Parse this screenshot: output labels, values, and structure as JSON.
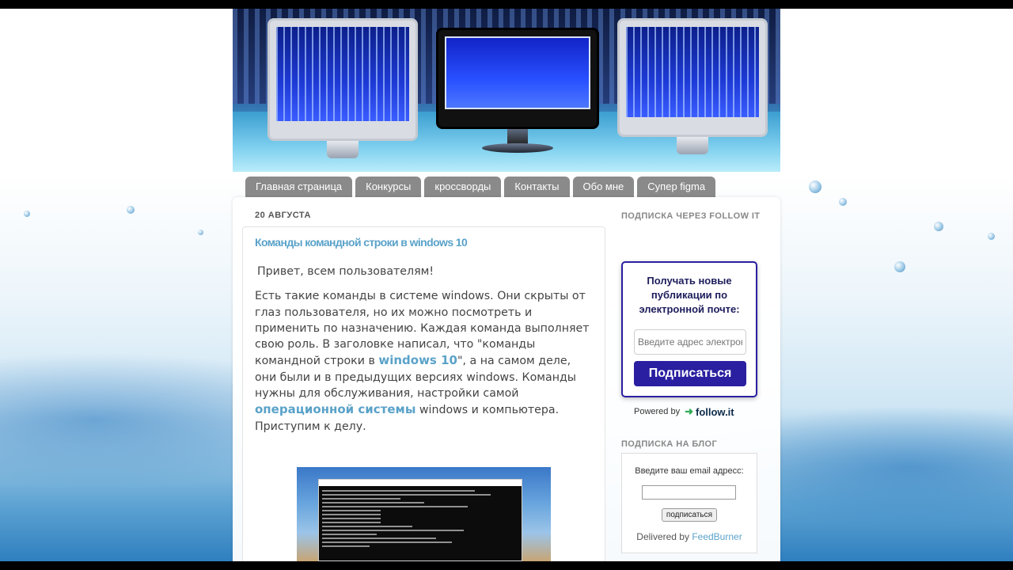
{
  "nav": {
    "tabs": [
      {
        "label": "Главная страница"
      },
      {
        "label": "Конкурсы"
      },
      {
        "label": "кроссворды"
      },
      {
        "label": "Контакты"
      },
      {
        "label": "Обо мне"
      },
      {
        "label": "Супер figma"
      }
    ]
  },
  "post": {
    "date": "20 АВГУСТА",
    "title": "Команды командной строки в windows 10",
    "greeting": "Привет, всем пользователям!",
    "body_part1": "Есть такие команды в системе windows. Они скрыты от глаз пользователя, но их можно посмотреть и применить по назначению. Каждая команда выполняет свою роль. В заголовке написал, что \"команды командной строки в ",
    "link1": "windows 10",
    "body_part2": "\", а на самом деле, они были и в предыдущих версиях windows. Команды нужны для обслуживания, настройки самой ",
    "link2": "операционной системы",
    "body_part3": " windows и компьютера. Приступим к делу."
  },
  "sidebar": {
    "follow": {
      "heading": "ПОДПИСКА ЧЕРЕЗ FOLLOW IT",
      "box_title": "Получать новые публикации по электронной почте:",
      "input_placeholder": "Введите адрес электронной почты",
      "button_label": "Подписаться",
      "powered_by": "Powered by",
      "brand": "follow.it"
    },
    "feedburner": {
      "heading": "ПОДПИСКА НА БЛОГ",
      "label": "Введите ваш email адресс:",
      "button_label": "подписаться",
      "delivered_by": "Delivered by",
      "brand": "FeedBurner"
    }
  },
  "colors": {
    "accent_link": "#5aa2c9",
    "follow_button": "#2a1fa0",
    "tab_bg": "#8a8a8a"
  }
}
